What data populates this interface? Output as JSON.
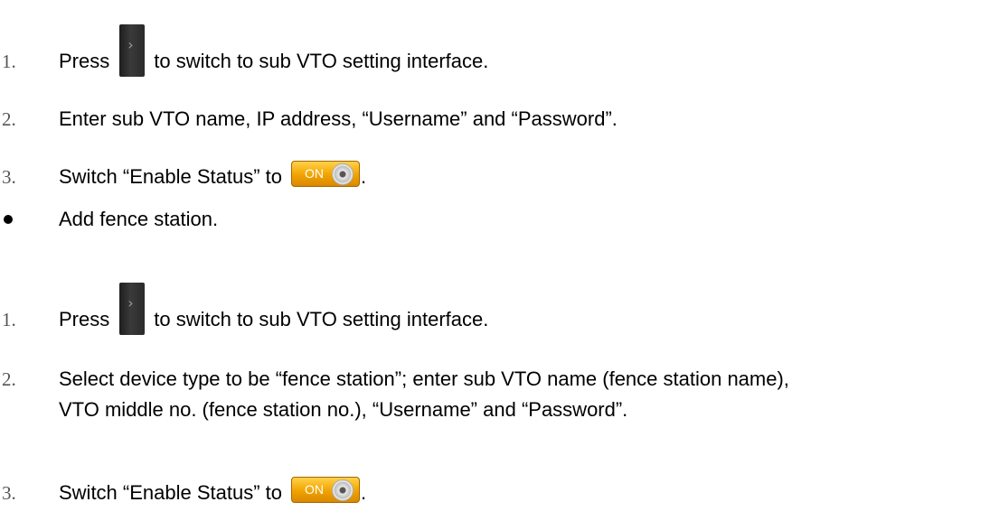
{
  "steps": [
    {
      "num": "1.",
      "before": "Press",
      "icon": "next-arrow-icon",
      "after": "to switch to sub VTO setting interface."
    },
    {
      "num": "2.",
      "text": "Enter sub VTO name, IP address, “Username” and “Password”."
    },
    {
      "num": "3.",
      "before": "Switch “Enable Status” to",
      "icon": "on-toggle-icon",
      "after": "."
    },
    {
      "bullet": "●",
      "text": "Add fence station."
    },
    {
      "num": "1.",
      "before": "Press",
      "icon": "next-arrow-icon",
      "after": "to switch to sub VTO setting interface."
    },
    {
      "num": "2.",
      "line1": "Select device type to be “fence station”; enter sub VTO name (fence station name),",
      "line2": "VTO middle no. (fence station no.), “Username” and “Password”."
    },
    {
      "num": "3.",
      "before": "Switch “Enable Status” to",
      "icon": "on-toggle-icon",
      "after": "."
    }
  ],
  "toggle": {
    "label": "ON"
  },
  "colors": {
    "toggle": "#f1a300",
    "icon_bg": "#2a2a2a"
  }
}
